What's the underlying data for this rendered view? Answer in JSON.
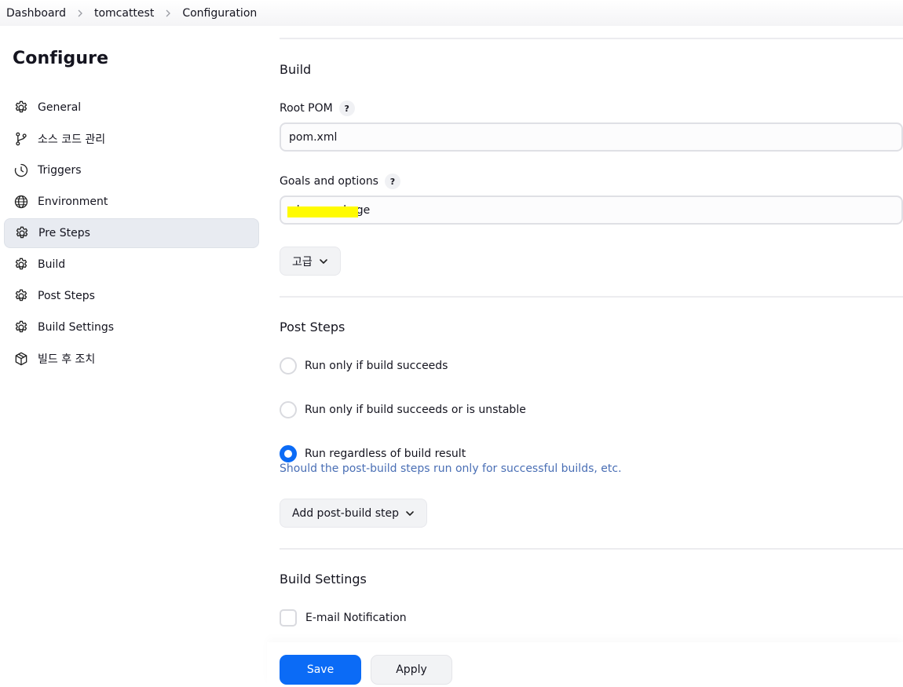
{
  "breadcrumb": {
    "items": [
      "Dashboard",
      "tomcattest",
      "Configuration"
    ]
  },
  "sidebar": {
    "title": "Configure",
    "items": [
      {
        "label": "General",
        "icon": "gear-icon"
      },
      {
        "label": "소스 코드 관리",
        "icon": "branch-icon"
      },
      {
        "label": "Triggers",
        "icon": "clock-icon"
      },
      {
        "label": "Environment",
        "icon": "globe-icon"
      },
      {
        "label": "Pre Steps",
        "icon": "gear-icon",
        "active": true
      },
      {
        "label": "Build",
        "icon": "gear-icon"
      },
      {
        "label": "Post Steps",
        "icon": "gear-icon"
      },
      {
        "label": "Build Settings",
        "icon": "gear-icon"
      },
      {
        "label": "빌드 후 조치",
        "icon": "package-icon"
      }
    ]
  },
  "build": {
    "title": "Build",
    "root_pom_label": "Root POM",
    "root_pom_value": "pom.xml",
    "goals_label": "Goals and options",
    "goals_value": "clean package",
    "advanced_button": "고급",
    "help_badge": "?"
  },
  "post_steps": {
    "title": "Post Steps",
    "options": [
      {
        "label": "Run only if build succeeds",
        "checked": false
      },
      {
        "label": "Run only if build succeeds or is unstable",
        "checked": false
      },
      {
        "label": "Run regardless of build result",
        "checked": true
      }
    ],
    "help_text": "Should the post-build steps run only for successful builds, etc.",
    "add_button": "Add post-build step"
  },
  "build_settings": {
    "title": "Build Settings",
    "email_label": "E-mail Notification",
    "email_checked": false
  },
  "footer": {
    "save_label": "Save",
    "apply_label": "Apply"
  },
  "colors": {
    "primary": "#0b6bf6",
    "highlight": "#fffb00",
    "help_text": "#4a6fb5"
  }
}
